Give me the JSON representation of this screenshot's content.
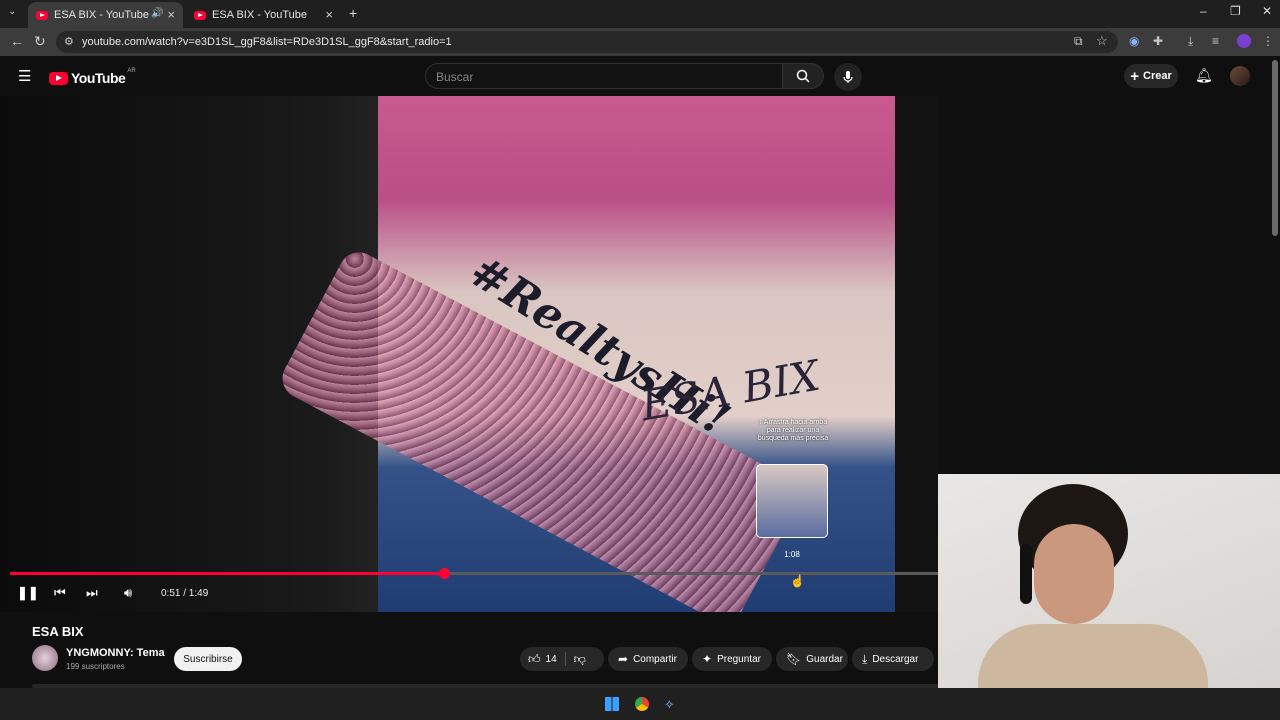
{
  "browser": {
    "tabs": [
      {
        "title": "ESA BIX - YouTube",
        "active": true,
        "audio": true
      },
      {
        "title": "ESA BIX - YouTube",
        "active": false
      }
    ],
    "url": "youtube.com/watch?v=e3D1SL_ggF8&list=RDe3D1SL_ggF8&start_radio=1"
  },
  "youtube": {
    "logo_text": "YouTube",
    "country_code": "AR",
    "search_placeholder": "Buscar",
    "create_label": "Crear"
  },
  "player": {
    "thumbnail_text_1": "#RealtysHi!",
    "thumbnail_text_2": "ESA BIX",
    "preview_hint": "↕ Arrastra hacia arriba para realizar una búsqueda más precisa",
    "preview_time": "1:08",
    "time_display": "0:51 / 1:49",
    "progress_fraction": 0.4679,
    "colors": {
      "accent": "#ff0033"
    }
  },
  "video": {
    "title": "ESA BIX",
    "channel": "YNGMONNY: Tema",
    "subscribers": "199 suscriptores",
    "subscribe_label": "Suscribirse",
    "likes": "14",
    "share_label": "Compartir",
    "ask_label": "Preguntar",
    "save_label": "Guardar",
    "download_label": "Descargar"
  }
}
